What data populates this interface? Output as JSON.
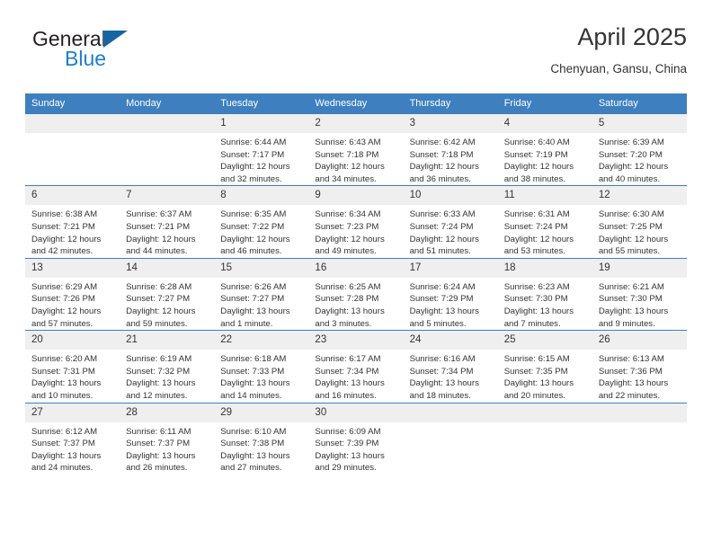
{
  "brand": {
    "name_part1": "General",
    "name_part2": "Blue",
    "triangle_color": "#1565a5",
    "blue_color": "#1b7fd4"
  },
  "header": {
    "title": "April 2025",
    "subtitle": "Chenyuan, Gansu, China"
  },
  "theme": {
    "header_bg": "#3d7fbf",
    "daynum_bg": "#efefef",
    "text": "#333333"
  },
  "calendar": {
    "weekdays": [
      "Sunday",
      "Monday",
      "Tuesday",
      "Wednesday",
      "Thursday",
      "Friday",
      "Saturday"
    ],
    "weeks": [
      [
        {
          "day": "",
          "sunrise": "",
          "sunset": "",
          "daylight": ""
        },
        {
          "day": "",
          "sunrise": "",
          "sunset": "",
          "daylight": ""
        },
        {
          "day": "1",
          "sunrise": "Sunrise: 6:44 AM",
          "sunset": "Sunset: 7:17 PM",
          "daylight": "Daylight: 12 hours and 32 minutes."
        },
        {
          "day": "2",
          "sunrise": "Sunrise: 6:43 AM",
          "sunset": "Sunset: 7:18 PM",
          "daylight": "Daylight: 12 hours and 34 minutes."
        },
        {
          "day": "3",
          "sunrise": "Sunrise: 6:42 AM",
          "sunset": "Sunset: 7:18 PM",
          "daylight": "Daylight: 12 hours and 36 minutes."
        },
        {
          "day": "4",
          "sunrise": "Sunrise: 6:40 AM",
          "sunset": "Sunset: 7:19 PM",
          "daylight": "Daylight: 12 hours and 38 minutes."
        },
        {
          "day": "5",
          "sunrise": "Sunrise: 6:39 AM",
          "sunset": "Sunset: 7:20 PM",
          "daylight": "Daylight: 12 hours and 40 minutes."
        }
      ],
      [
        {
          "day": "6",
          "sunrise": "Sunrise: 6:38 AM",
          "sunset": "Sunset: 7:21 PM",
          "daylight": "Daylight: 12 hours and 42 minutes."
        },
        {
          "day": "7",
          "sunrise": "Sunrise: 6:37 AM",
          "sunset": "Sunset: 7:21 PM",
          "daylight": "Daylight: 12 hours and 44 minutes."
        },
        {
          "day": "8",
          "sunrise": "Sunrise: 6:35 AM",
          "sunset": "Sunset: 7:22 PM",
          "daylight": "Daylight: 12 hours and 46 minutes."
        },
        {
          "day": "9",
          "sunrise": "Sunrise: 6:34 AM",
          "sunset": "Sunset: 7:23 PM",
          "daylight": "Daylight: 12 hours and 49 minutes."
        },
        {
          "day": "10",
          "sunrise": "Sunrise: 6:33 AM",
          "sunset": "Sunset: 7:24 PM",
          "daylight": "Daylight: 12 hours and 51 minutes."
        },
        {
          "day": "11",
          "sunrise": "Sunrise: 6:31 AM",
          "sunset": "Sunset: 7:24 PM",
          "daylight": "Daylight: 12 hours and 53 minutes."
        },
        {
          "day": "12",
          "sunrise": "Sunrise: 6:30 AM",
          "sunset": "Sunset: 7:25 PM",
          "daylight": "Daylight: 12 hours and 55 minutes."
        }
      ],
      [
        {
          "day": "13",
          "sunrise": "Sunrise: 6:29 AM",
          "sunset": "Sunset: 7:26 PM",
          "daylight": "Daylight: 12 hours and 57 minutes."
        },
        {
          "day": "14",
          "sunrise": "Sunrise: 6:28 AM",
          "sunset": "Sunset: 7:27 PM",
          "daylight": "Daylight: 12 hours and 59 minutes."
        },
        {
          "day": "15",
          "sunrise": "Sunrise: 6:26 AM",
          "sunset": "Sunset: 7:27 PM",
          "daylight": "Daylight: 13 hours and 1 minute."
        },
        {
          "day": "16",
          "sunrise": "Sunrise: 6:25 AM",
          "sunset": "Sunset: 7:28 PM",
          "daylight": "Daylight: 13 hours and 3 minutes."
        },
        {
          "day": "17",
          "sunrise": "Sunrise: 6:24 AM",
          "sunset": "Sunset: 7:29 PM",
          "daylight": "Daylight: 13 hours and 5 minutes."
        },
        {
          "day": "18",
          "sunrise": "Sunrise: 6:23 AM",
          "sunset": "Sunset: 7:30 PM",
          "daylight": "Daylight: 13 hours and 7 minutes."
        },
        {
          "day": "19",
          "sunrise": "Sunrise: 6:21 AM",
          "sunset": "Sunset: 7:30 PM",
          "daylight": "Daylight: 13 hours and 9 minutes."
        }
      ],
      [
        {
          "day": "20",
          "sunrise": "Sunrise: 6:20 AM",
          "sunset": "Sunset: 7:31 PM",
          "daylight": "Daylight: 13 hours and 10 minutes."
        },
        {
          "day": "21",
          "sunrise": "Sunrise: 6:19 AM",
          "sunset": "Sunset: 7:32 PM",
          "daylight": "Daylight: 13 hours and 12 minutes."
        },
        {
          "day": "22",
          "sunrise": "Sunrise: 6:18 AM",
          "sunset": "Sunset: 7:33 PM",
          "daylight": "Daylight: 13 hours and 14 minutes."
        },
        {
          "day": "23",
          "sunrise": "Sunrise: 6:17 AM",
          "sunset": "Sunset: 7:34 PM",
          "daylight": "Daylight: 13 hours and 16 minutes."
        },
        {
          "day": "24",
          "sunrise": "Sunrise: 6:16 AM",
          "sunset": "Sunset: 7:34 PM",
          "daylight": "Daylight: 13 hours and 18 minutes."
        },
        {
          "day": "25",
          "sunrise": "Sunrise: 6:15 AM",
          "sunset": "Sunset: 7:35 PM",
          "daylight": "Daylight: 13 hours and 20 minutes."
        },
        {
          "day": "26",
          "sunrise": "Sunrise: 6:13 AM",
          "sunset": "Sunset: 7:36 PM",
          "daylight": "Daylight: 13 hours and 22 minutes."
        }
      ],
      [
        {
          "day": "27",
          "sunrise": "Sunrise: 6:12 AM",
          "sunset": "Sunset: 7:37 PM",
          "daylight": "Daylight: 13 hours and 24 minutes."
        },
        {
          "day": "28",
          "sunrise": "Sunrise: 6:11 AM",
          "sunset": "Sunset: 7:37 PM",
          "daylight": "Daylight: 13 hours and 26 minutes."
        },
        {
          "day": "29",
          "sunrise": "Sunrise: 6:10 AM",
          "sunset": "Sunset: 7:38 PM",
          "daylight": "Daylight: 13 hours and 27 minutes."
        },
        {
          "day": "30",
          "sunrise": "Sunrise: 6:09 AM",
          "sunset": "Sunset: 7:39 PM",
          "daylight": "Daylight: 13 hours and 29 minutes."
        },
        {
          "day": "",
          "sunrise": "",
          "sunset": "",
          "daylight": ""
        },
        {
          "day": "",
          "sunrise": "",
          "sunset": "",
          "daylight": ""
        },
        {
          "day": "",
          "sunrise": "",
          "sunset": "",
          "daylight": ""
        }
      ]
    ]
  }
}
